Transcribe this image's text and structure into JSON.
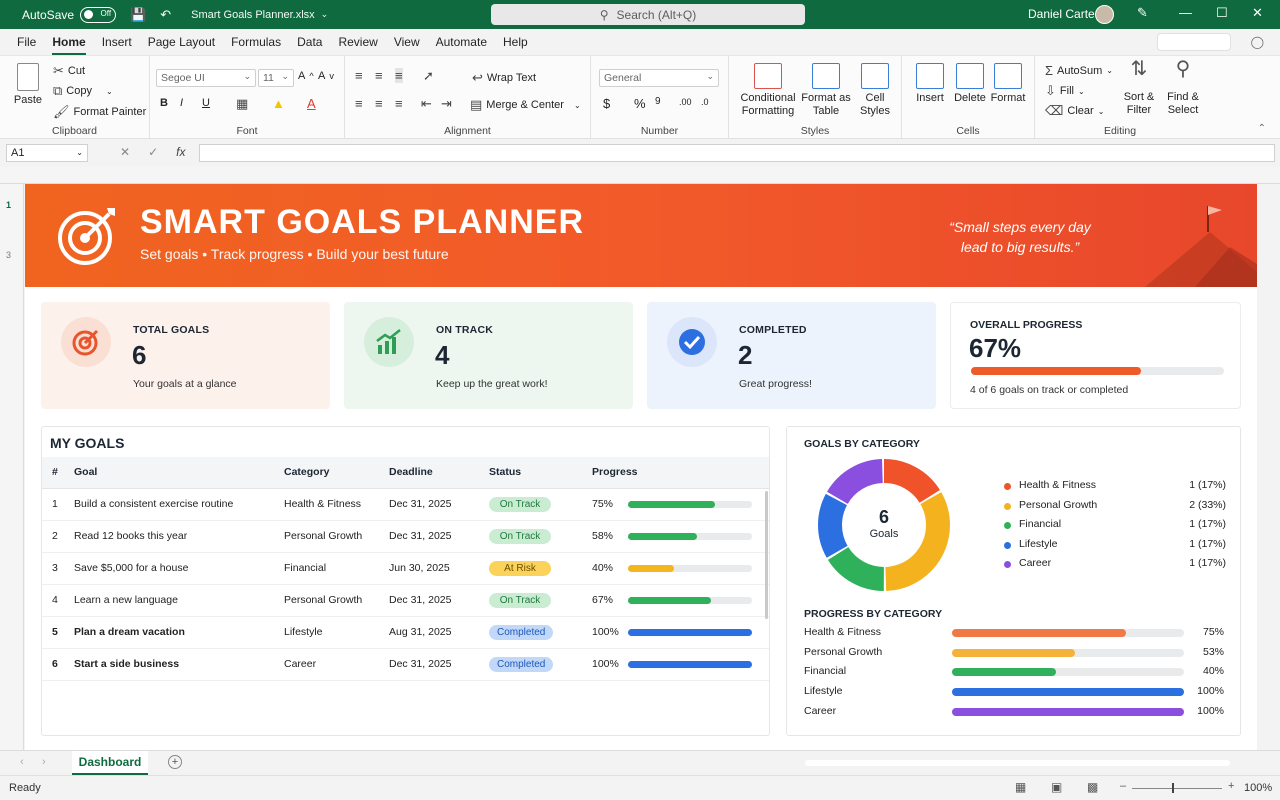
{
  "titlebar": {
    "autosave_label": "AutoSave",
    "toggle_state": "Off",
    "file_name": "Smart Goals Planner.xlsx",
    "search_placeholder": "Search (Alt+Q)",
    "user_name": "Daniel Carter"
  },
  "menu": [
    "File",
    "Home",
    "Insert",
    "Page Layout",
    "Formulas",
    "Data",
    "Review",
    "View",
    "Automate",
    "Help"
  ],
  "ribbon": {
    "clipboard": {
      "paste": "Paste",
      "cut": "Cut",
      "copy": "Copy",
      "format_painter": "Format Painter",
      "label": "Clipboard"
    },
    "font": {
      "family": "Segoe UI",
      "size": "11",
      "label": "Font"
    },
    "alignment": {
      "wrap_text": "Wrap Text",
      "merge_center": "Merge & Center",
      "label": "Alignment"
    },
    "number": {
      "format": "General",
      "label": "Number"
    },
    "styles": {
      "conditional": "Conditional Formatting",
      "format_table": "Format as Table",
      "cell_styles": "Cell Styles",
      "label": "Styles"
    },
    "cells": {
      "insert": "Insert",
      "delete": "Delete",
      "format": "Format",
      "label": "Cells"
    },
    "editing": {
      "autosum": "AutoSum",
      "fill": "Fill",
      "clear": "Clear",
      "sort_filter": "Sort & Filter",
      "find_select": "Find & Select",
      "label": "Editing"
    }
  },
  "formula_bar": {
    "name_box": "A1",
    "fx": "fx",
    "value": ""
  },
  "banner": {
    "title": "SMART GOALS PLANNER",
    "subtitle": "Set goals  •  Track progress  •  Build your best future",
    "quote": "“Small steps every day lead to big results.”"
  },
  "cards": [
    {
      "label": "TOTAL GOALS",
      "value": "6",
      "desc": "Your goals at a glance",
      "bg": "#fdf1ec",
      "circle": "#fadfd4",
      "icon": "target-icon",
      "color": "#e8552c"
    },
    {
      "label": "ON TRACK",
      "value": "4",
      "desc": "Keep up the great work!",
      "bg": "#edf7f0",
      "circle": "#d6efdd",
      "icon": "chart-up-icon",
      "color": "#2f9e55"
    },
    {
      "label": "COMPLETED",
      "value": "2",
      "desc": "Great progress!",
      "bg": "#edf3fd",
      "circle": "#dbe6fb",
      "icon": "check-icon",
      "color": "#2c6fe0"
    }
  ],
  "overall": {
    "label": "OVERALL PROGRESS",
    "value": "67%",
    "fraction": 0.67,
    "desc": "4 of 6 goals on track or completed",
    "color": "#ee5b28"
  },
  "goals_table": {
    "title": "MY GOALS",
    "headers": [
      "#",
      "Goal",
      "Category",
      "Deadline",
      "Status",
      "Progress"
    ],
    "rows": [
      {
        "n": "1",
        "goal": "Build a consistent exercise routine",
        "category": "Health & Fitness",
        "deadline": "Dec 31, 2025",
        "status": "On Track",
        "progress": "75%",
        "p": 0.7,
        "color": "#2fb05a",
        "bold": false
      },
      {
        "n": "2",
        "goal": "Read 12 books this year",
        "category": "Personal Growth",
        "deadline": "Dec 31, 2025",
        "status": "On Track",
        "progress": "58%",
        "p": 0.56,
        "color": "#2fb05a",
        "bold": false
      },
      {
        "n": "3",
        "goal": "Save $5,000 for a house",
        "category": "Financial",
        "deadline": "Jun 30, 2025",
        "status": "At Risk",
        "progress": "40%",
        "p": 0.37,
        "color": "#f3b61f",
        "bold": false
      },
      {
        "n": "4",
        "goal": "Learn a new language",
        "category": "Personal Growth",
        "deadline": "Dec 31, 2025",
        "status": "On Track",
        "progress": "67%",
        "p": 0.67,
        "color": "#2fb05a",
        "bold": false
      },
      {
        "n": "5",
        "goal": "Plan a dream vacation",
        "category": "Lifestyle",
        "deadline": "Aug 31, 2025",
        "status": "Completed",
        "progress": "100%",
        "p": 1.0,
        "color": "#2c6fe0",
        "bold": true
      },
      {
        "n": "6",
        "goal": "Start a side business",
        "category": "Career",
        "deadline": "Dec 31, 2025",
        "status": "Completed",
        "progress": "100%",
        "p": 1.0,
        "color": "#2c6fe0",
        "bold": true
      }
    ]
  },
  "status_styles": {
    "On Track": {
      "bg": "#c9ecd3",
      "fg": "#1f7a3f"
    },
    "At Risk": {
      "bg": "#fbd35a",
      "fg": "#6b4d00"
    },
    "Completed": {
      "bg": "#c2d8f8",
      "fg": "#1d57b8"
    }
  },
  "category_chart": {
    "title": "GOALS BY CATEGORY",
    "center_value": "6",
    "center_label": "Goals",
    "items": [
      {
        "name": "Health & Fitness",
        "value": "1 (17%)",
        "share": 1,
        "color": "#f0522a"
      },
      {
        "name": "Personal Growth",
        "value": "2 (33%)",
        "share": 2,
        "color": "#f5b21f"
      },
      {
        "name": "Financial",
        "value": "1 (17%)",
        "share": 1,
        "color": "#2fb05a"
      },
      {
        "name": "Lifestyle",
        "value": "1 (17%)",
        "share": 1,
        "color": "#2c6fe0"
      },
      {
        "name": "Career",
        "value": "1 (17%)",
        "share": 1,
        "color": "#8b4fe0"
      }
    ]
  },
  "progress_by_category": {
    "title": "PROGRESS BY CATEGORY",
    "items": [
      {
        "name": "Health & Fitness",
        "value": "75%",
        "p": 0.75,
        "color": "#f07a45"
      },
      {
        "name": "Personal Growth",
        "value": "53%",
        "p": 0.53,
        "color": "#f5b23a"
      },
      {
        "name": "Financial",
        "value": "40%",
        "p": 0.45,
        "color": "#2fb05a"
      },
      {
        "name": "Lifestyle",
        "value": "100%",
        "p": 1.0,
        "color": "#2c6fe0"
      },
      {
        "name": "Career",
        "value": "100%",
        "p": 1.0,
        "color": "#8b4fe0"
      }
    ]
  },
  "sheet_tab": "Dashboard",
  "status": {
    "ready": "Ready",
    "zoom": "100%"
  }
}
